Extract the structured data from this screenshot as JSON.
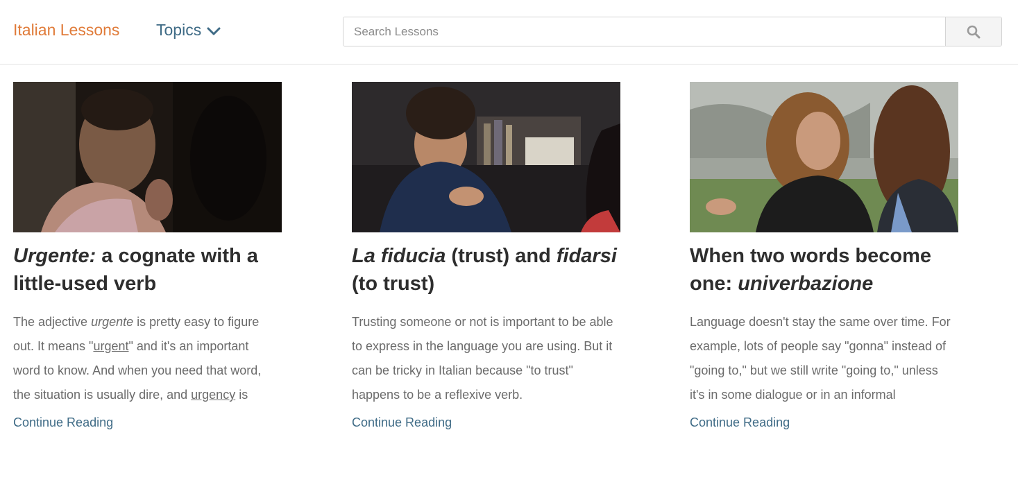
{
  "header": {
    "brand": "Italian Lessons",
    "topics_label": "Topics",
    "search_placeholder": "Search Lessons"
  },
  "colors": {
    "brand": "#e07b39",
    "link": "#3f6b86",
    "excerpt": "#6b6b6b",
    "title": "#2e2e2e"
  },
  "icons": {
    "topics_chevron": "chevron-down-icon",
    "search": "search-icon"
  },
  "articles": [
    {
      "title_em": "Urgente:",
      "title_rest": " a cognate with a little-used verb",
      "excerpt_p1": "The adjective ",
      "excerpt_em": "urgente",
      "excerpt_p2": " is pretty easy to figure out. It means \"",
      "excerpt_link1": "urgent",
      "excerpt_p3": "\" and it's an important word to know. And when you need that word, the situation is usually dire, and ",
      "excerpt_link2": "urgency",
      "excerpt_p4": " is",
      "continue": "Continue Reading"
    },
    {
      "title_em1": "La fiducia",
      "title_mid": " (trust) and ",
      "title_em2": "fidarsi",
      "title_end": " (to trust)",
      "excerpt": "Trusting someone or not is important to be able to express in the language you are using. But it can be tricky in Italian because \"to trust\" happens to be a reflexive verb.",
      "continue": "Continue Reading"
    },
    {
      "title_start": "When two words become one: ",
      "title_em": "univerbazione",
      "excerpt": "Language doesn't stay the same over time. For example, lots of people say \"gonna\" instead of \"going to,\" but we still write \"going to,\" unless it's in some dialogue or in an informal",
      "continue": "Continue Reading"
    }
  ]
}
